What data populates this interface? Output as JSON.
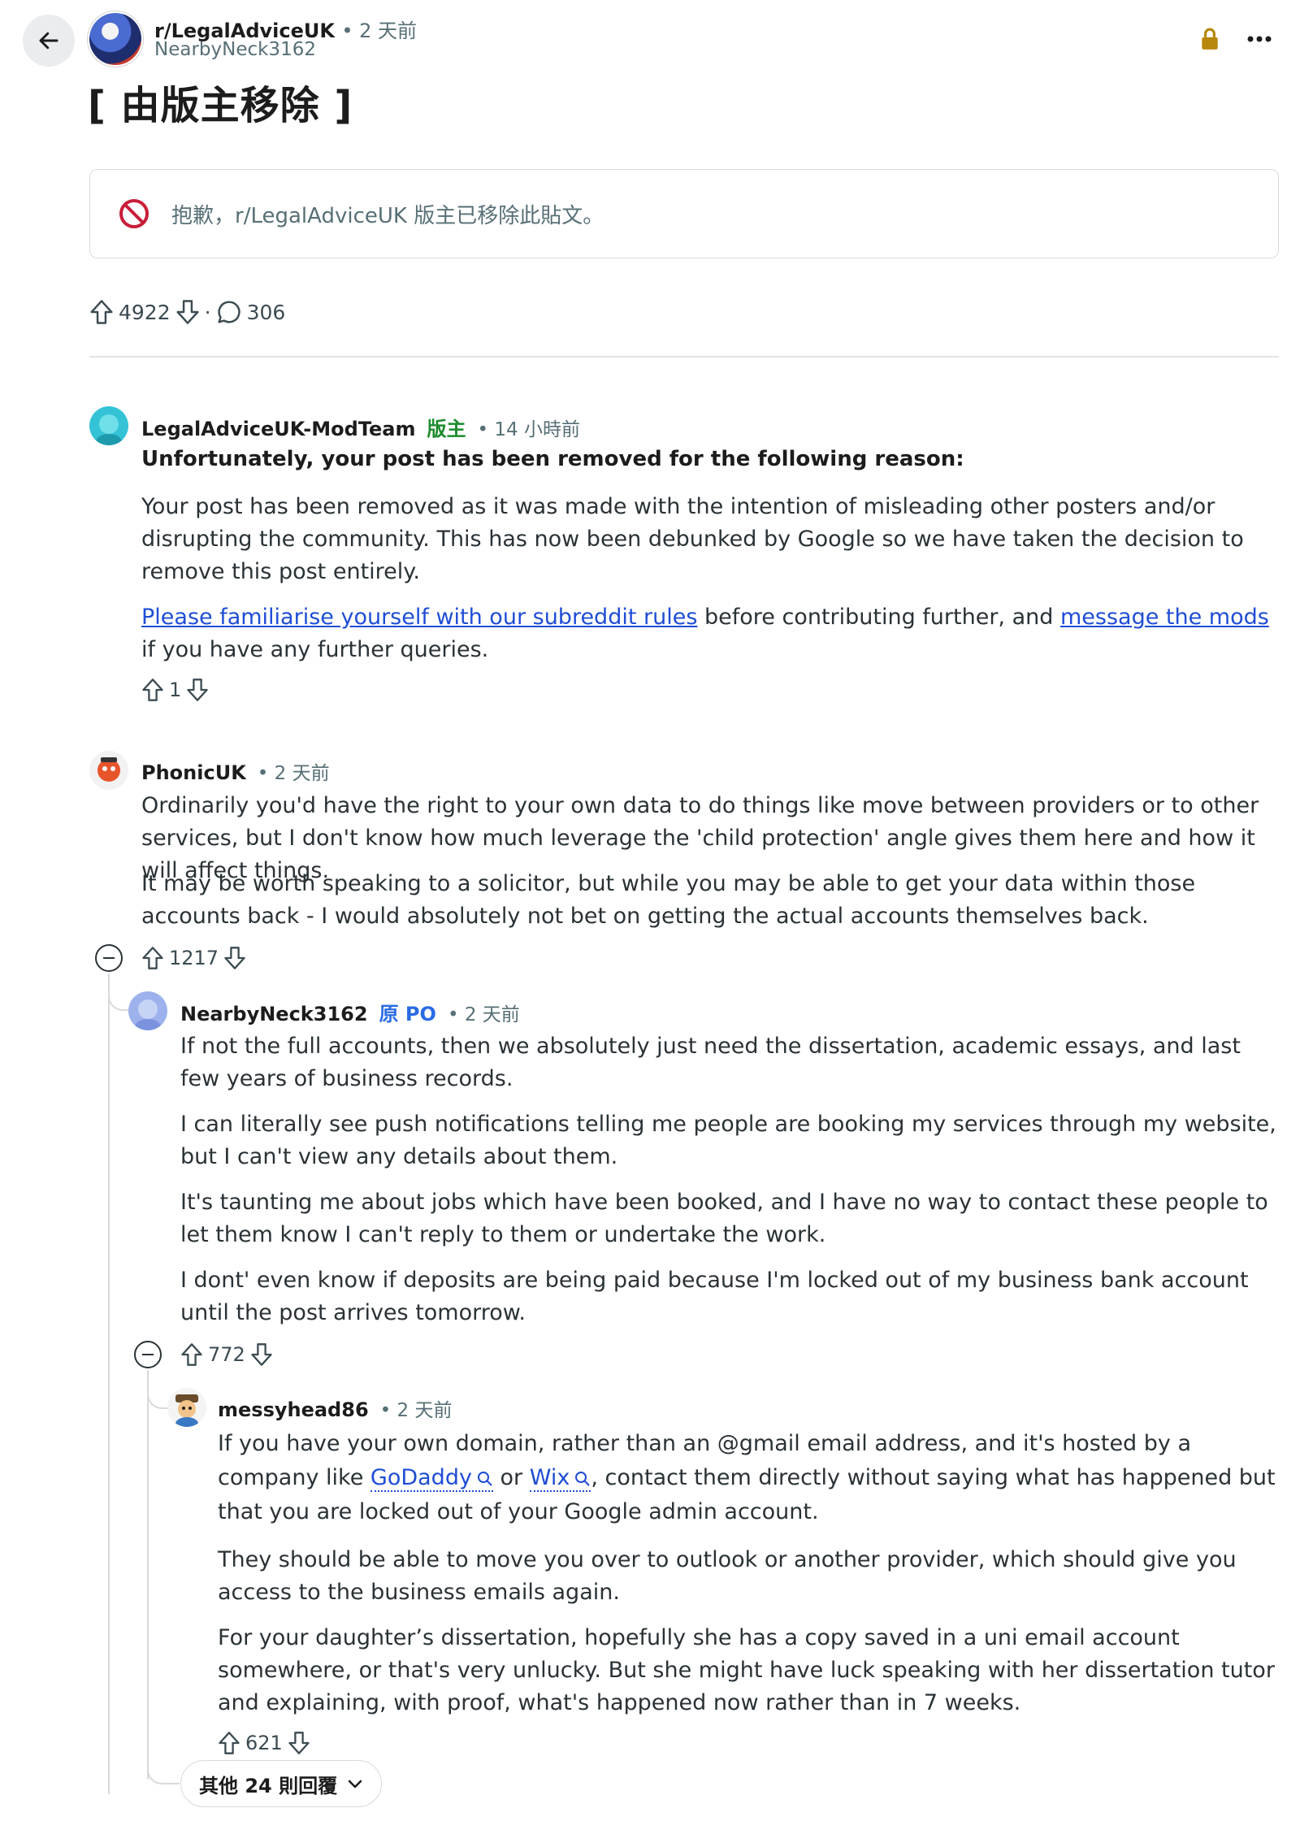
{
  "header": {
    "subreddit": "r/LegalAdviceUK",
    "time": "• 2 天前",
    "author": "NearbyNeck3162"
  },
  "post": {
    "title": "[ 由版主移除 ]",
    "removed_notice": "抱歉，r/LegalAdviceUK 版主已移除此貼文。",
    "upvotes": "4922",
    "dot": "·",
    "comments": "306"
  },
  "comments": [
    {
      "author": "LegalAdviceUK-ModTeam",
      "badge": "版主",
      "time": "• 14 小時前",
      "heading": "Unfortunately, your post has been removed for the following reason:",
      "para1": "Your post has been removed as it was made with the intention of misleading other posters and/or disrupting the community. This has now been debunked by Google so we have taken the decision to remove this post entirely.",
      "link1": "Please familiarise yourself with our subreddit rules",
      "mid_text": " before contributing further, and ",
      "link2": "message the mods",
      "end_text": " if you have any further queries.",
      "votes": "1"
    },
    {
      "author": "PhonicUK",
      "time": "• 2 天前",
      "para1": "Ordinarily you'd have the right to your own data to do things like move between providers or to other services, but I don't know how much leverage the 'child protection' angle gives them here and how it will affect things.",
      "para2": "It may be worth speaking to a solicitor, but while you may be able to get your data within those accounts back - I would absolutely not bet on getting the actual accounts themselves back.",
      "votes": "1217"
    },
    {
      "author": "NearbyNeck3162",
      "badge": "原 PO",
      "time": "• 2 天前",
      "para1": "If not the full accounts, then we absolutely just need the dissertation, academic essays, and last few years of business records.",
      "para2": "I can literally see push notifications telling me people are booking my services through my website, but I can't view any details about them.",
      "para3": "It's taunting me about jobs which have been booked, and I have no way to contact these people to let them know I can't reply to them or undertake the work.",
      "para4": "I dont' even know if deposits are being paid because I'm locked out of my business bank account until the post arrives tomorrow.",
      "votes": "772"
    },
    {
      "author": "messyhead86",
      "time": "• 2 天前",
      "para1_a": "If you have your own domain, rather than an @gmail email address, and it's hosted by a company like ",
      "link_godaddy": "GoDaddy",
      "or_text": " or ",
      "link_wix": "Wix",
      "para1_b": ", contact them directly without saying what has happened but that you are locked out of your Google admin account.",
      "para2": "They should be able to move you over to outlook or another provider, which should give you access to the business emails again.",
      "para3": "For your daughter’s dissertation, hopefully she has a copy saved in a uni email account somewhere, or that's very unlucky. But she might have luck speaking with her dissertation tutor and explaining, with proof, what's happened now rather than in 7 weeks.",
      "votes": "621"
    }
  ],
  "more_replies": "其他 24 則回覆",
  "colors": {
    "mod_green": "#1c8a2c",
    "op_blue": "#2a6be4",
    "link_blue": "#1f4dd6",
    "lock_gold": "#b8860b",
    "removed_red": "#c81e3a"
  }
}
